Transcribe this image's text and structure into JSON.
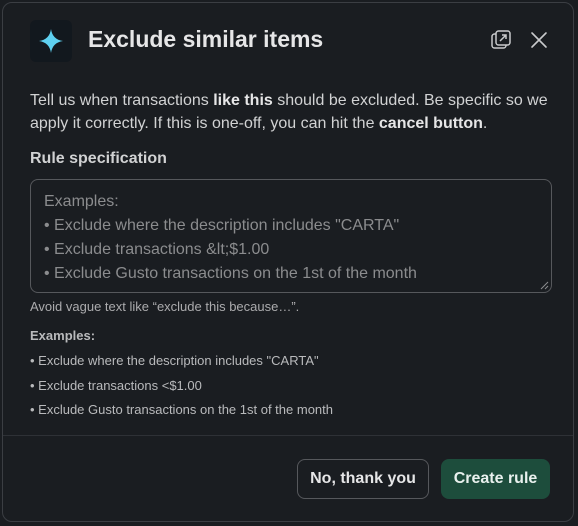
{
  "dialog": {
    "title": "Exclude similar items",
    "app_icon": "sparkle-icon",
    "header_icons": [
      "popout-icon",
      "close-icon"
    ],
    "description": {
      "part1": "Tell us when transactions ",
      "bold1": "like this",
      "part2": " should be excluded. Be specific so we apply it correctly. If this is one-off, you can hit the ",
      "bold2": "cancel button",
      "part3": "."
    },
    "rule_label": "Rule specification",
    "textarea": {
      "value": "",
      "placeholder_lines": [
        "Examples:",
        "• Exclude where the description includes \"CARTA\"",
        "• Exclude transactions &lt;$1.00",
        "• Exclude Gusto transactions on the 1st of the month"
      ]
    },
    "hint": "Avoid vague text like “exclude this because…”.",
    "examples": {
      "heading": "Examples:",
      "items": [
        "• Exclude where the description includes \"CARTA\"",
        "• Exclude transactions <$1.00",
        "• Exclude Gusto transactions on the 1st of the month"
      ]
    },
    "buttons": {
      "cancel": "No, thank you",
      "create": "Create rule"
    }
  },
  "colors": {
    "background": "#1a1d21",
    "accent_button": "#1d4d3c",
    "sparkle": "#5ed0f0"
  }
}
